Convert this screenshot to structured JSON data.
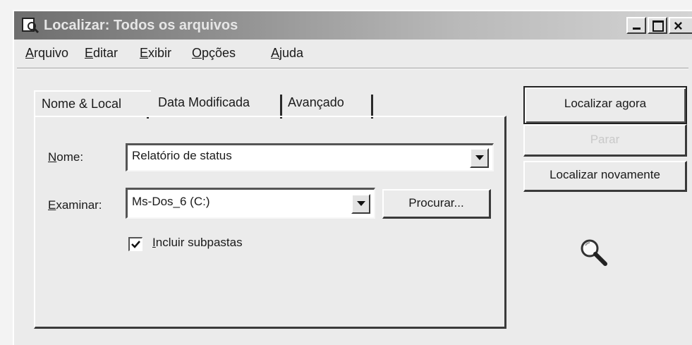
{
  "window": {
    "title": "Localizar: Todos os arquivos"
  },
  "menu": [
    "Arquivo",
    "Editar",
    "Exibir",
    "Opções",
    "Ajuda"
  ],
  "tabs": [
    "Nome & Local",
    "Data Modificada",
    "Avançado"
  ],
  "form": {
    "name_label": "Nome:",
    "name_value": "Relatório de status",
    "lookin_label": "Examinar:",
    "lookin_value": "Ms-Dos_6 (C:)",
    "browse_button": "Procurar...",
    "include_subfolders_label": "Incluir subpastas",
    "include_subfolders_checked": true
  },
  "buttons": {
    "find_now": "Localizar agora",
    "stop": "Parar",
    "new_search": "Localizar novamente"
  },
  "icons": {
    "search": "magnifier-icon"
  }
}
